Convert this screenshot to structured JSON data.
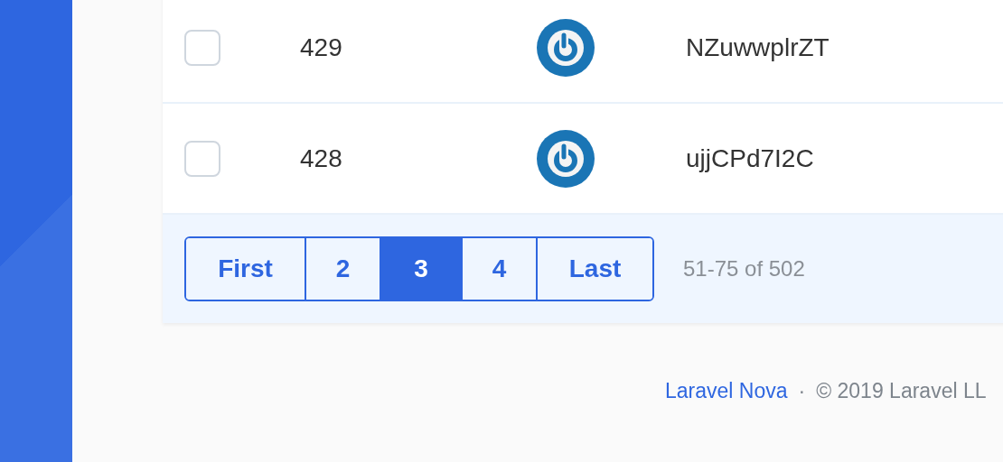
{
  "rows": [
    {
      "checked": false,
      "id": "429",
      "name": "NZuwwplrZT"
    },
    {
      "checked": false,
      "id": "428",
      "name": "ujjCPd7I2C"
    }
  ],
  "pagination": {
    "pages": [
      {
        "label": "First",
        "selected": false
      },
      {
        "label": "2",
        "selected": false
      },
      {
        "label": "3",
        "selected": true
      },
      {
        "label": "4",
        "selected": false
      },
      {
        "label": "Last",
        "selected": false
      }
    ],
    "range": "51-75 of 502"
  },
  "footer": {
    "link": "Laravel Nova",
    "separator": "·",
    "copyright": "© 2019 Laravel LL"
  }
}
